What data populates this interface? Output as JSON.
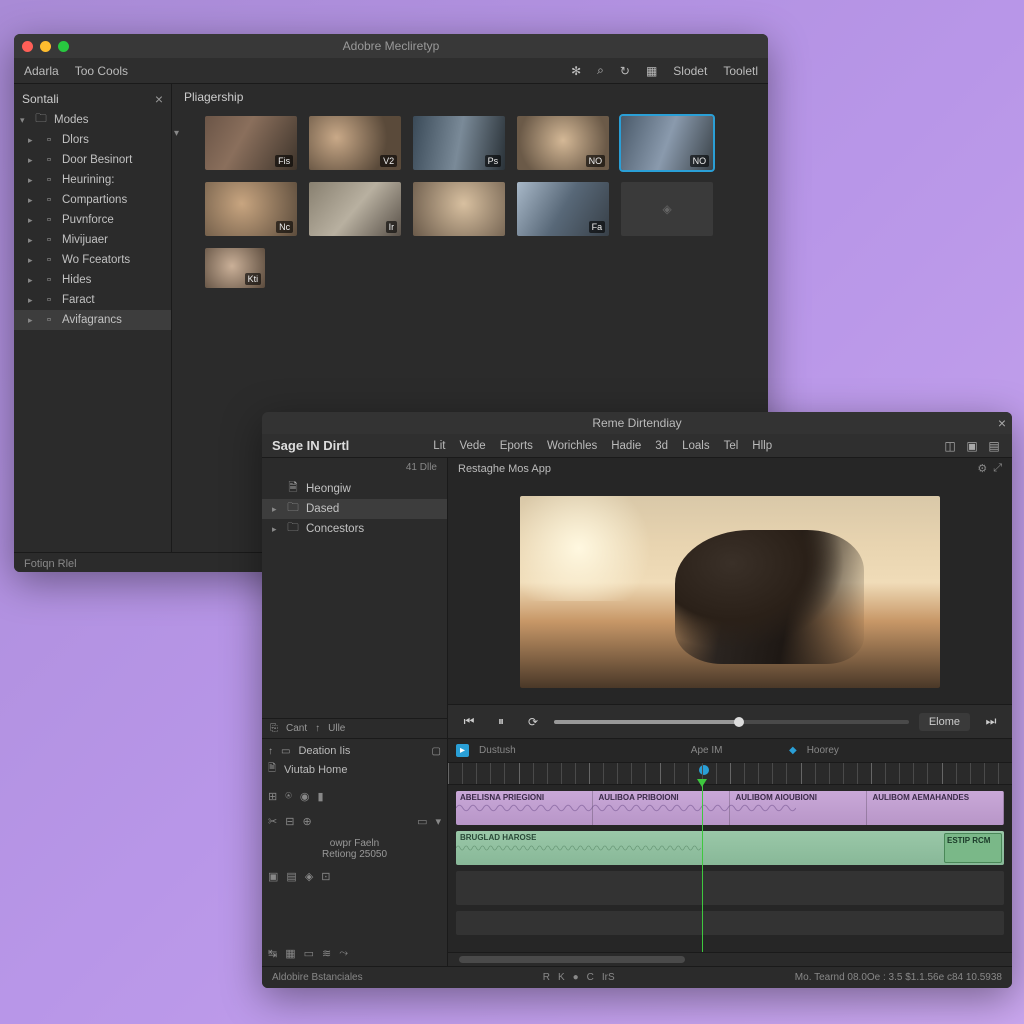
{
  "win1": {
    "title": "Adobre Mecliretyp",
    "toolbar": {
      "items": [
        "Adarla",
        "Too Cools"
      ],
      "right": [
        "Slodet",
        "Tooletl"
      ]
    },
    "sidebar_header": "Sontali",
    "tree_root": "Modes",
    "tree": [
      {
        "label": "Dlors",
        "icon": "folder"
      },
      {
        "label": "Door Besinort",
        "icon": "grid"
      },
      {
        "label": "Heurining:",
        "icon": "note"
      },
      {
        "label": "Compartions",
        "icon": "doc"
      },
      {
        "label": "Puvnforce",
        "icon": "wand"
      },
      {
        "label": "Mivijuaer",
        "icon": "film"
      },
      {
        "label": "Wo Fceatorts",
        "icon": "cloud"
      },
      {
        "label": "Hides",
        "icon": "doc"
      },
      {
        "label": "Faract",
        "icon": "doc"
      },
      {
        "label": "Avifagrancs",
        "icon": "tag",
        "selected": true
      }
    ],
    "panel_title": "Pliagership",
    "thumbs": [
      {
        "badge": "Fis",
        "cls": "grad1"
      },
      {
        "badge": "V2",
        "cls": "grad2"
      },
      {
        "badge": "Ps",
        "cls": "grad3"
      },
      {
        "badge": "NO",
        "cls": "grad4"
      },
      {
        "badge": "NO",
        "cls": "grad5",
        "selected": true
      },
      {
        "badge": "Nc",
        "cls": "grad6"
      },
      {
        "badge": "Ir",
        "cls": "grad7"
      },
      {
        "badge": "",
        "cls": "grad8"
      },
      {
        "badge": "Fa",
        "cls": "grad9"
      },
      {
        "badge": "",
        "cls": "placeholder",
        "placeholder": true
      },
      {
        "badge": "Kti",
        "cls": "grad10",
        "small": true
      }
    ],
    "status": "Fotiqn Rlel"
  },
  "win2": {
    "title": "Reme Dirtendiay",
    "left_title": "Sage IN Dirtl",
    "left_sub": "41 Dlle",
    "menubar": [
      "Lit",
      "Vede",
      "Eports",
      "Worichles",
      "Hadie",
      "3d",
      "Loals",
      "Tel",
      "Hllp"
    ],
    "tree": [
      {
        "label": "Heongiw",
        "icon": "doc"
      },
      {
        "label": "Dased",
        "icon": "folder",
        "selected": true
      },
      {
        "label": "Concestors",
        "icon": "folder"
      }
    ],
    "left_bottom": {
      "a": "Cant",
      "b": "Ulle"
    },
    "panel_title": "Restaghe Mos App",
    "transport": {
      "end_label": "Elome"
    },
    "bl": {
      "row1": "Deation Iis",
      "row2": "Viutab Home",
      "row5": "owpr Faeln",
      "row6": "Retiong 25050"
    },
    "tl_toolbar": [
      "Dustush",
      "Ape IM",
      "Hoorey"
    ],
    "ruler_labels": [
      "",
      "",
      ""
    ],
    "track_labels": {
      "v1a": "ABELISNA PRIEGIONI",
      "v1b": "AULIBOA PRIBOIONI",
      "v1c": "AULIBOM AIOUBIONI",
      "v1d": "AULIBOM AEMAHANDES",
      "a1": "BRUGLAD HAROSE",
      "a2": "ESTIP RCM"
    },
    "status": {
      "left": "Aldobire Bstanciales",
      "center": [
        "R",
        "K",
        "●",
        "C",
        "IrS"
      ],
      "right": "Mo. Tearnd 08.0Oe : 3.5   $1.1.56e c84 10.5938"
    }
  }
}
